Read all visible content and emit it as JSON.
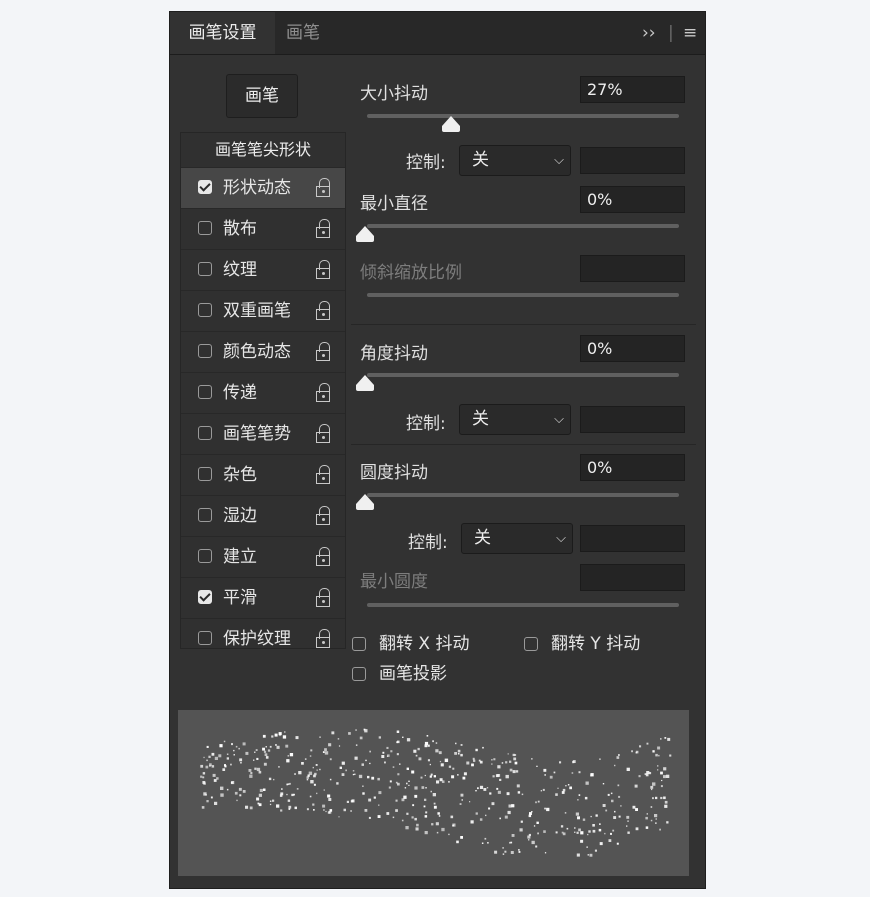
{
  "tabs": {
    "active": "画笔设置",
    "inactive": "画笔",
    "collapse_icon": "double-chevron-right-icon",
    "menu_icon": "menu-icon"
  },
  "brush_button": "画笔",
  "list": {
    "header": "画笔笔尖形状",
    "items": [
      {
        "label": "形状动态",
        "checked": true,
        "selected": true
      },
      {
        "label": "散布",
        "checked": false
      },
      {
        "label": "纹理",
        "checked": false
      },
      {
        "label": "双重画笔",
        "checked": false
      },
      {
        "label": "颜色动态",
        "checked": false
      },
      {
        "label": "传递",
        "checked": false
      },
      {
        "label": "画笔笔势",
        "checked": false
      },
      {
        "label": "杂色",
        "checked": false
      },
      {
        "label": "湿边",
        "checked": false
      },
      {
        "label": "建立",
        "checked": false
      },
      {
        "label": "平滑",
        "checked": true
      },
      {
        "label": "保护纹理",
        "checked": false
      }
    ]
  },
  "settings": {
    "size_jitter": {
      "label": "大小抖动",
      "value": "27%",
      "slider": 0.27
    },
    "control_label": "控制:",
    "control_value": "关",
    "min_diameter": {
      "label": "最小直径",
      "value": "0%",
      "slider": 0
    },
    "tilt_scale": {
      "label": "倾斜缩放比例"
    },
    "angle_jitter": {
      "label": "角度抖动",
      "value": "0%",
      "slider": 0
    },
    "roundness_jitter": {
      "label": "圆度抖动",
      "value": "0%",
      "slider": 0
    },
    "min_roundness": {
      "label": "最小圆度"
    }
  },
  "options": {
    "flip_x": "翻转 X 抖动",
    "flip_y": "翻转 Y 抖动",
    "brush_projection": "画笔投影"
  },
  "colors": {
    "panel": "#323232",
    "preview": "#545454",
    "accent": "#f0f0f0"
  }
}
